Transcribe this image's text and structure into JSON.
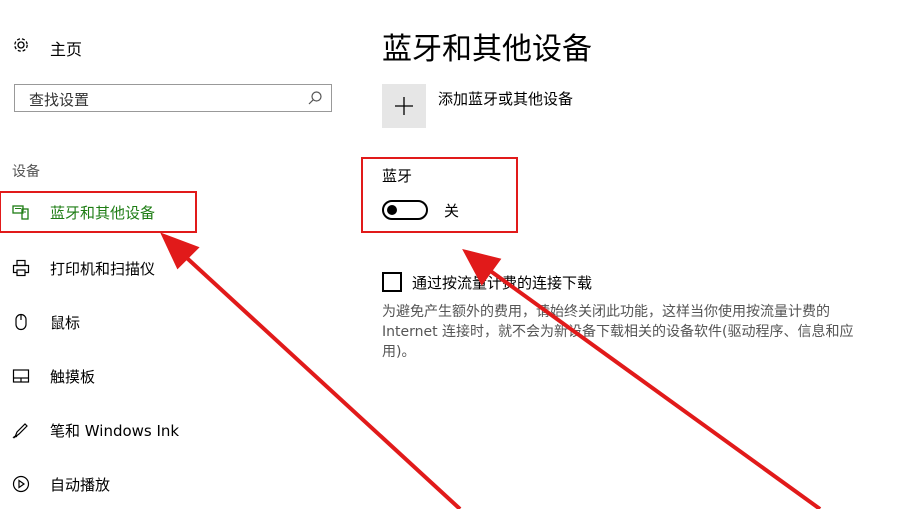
{
  "sidebar": {
    "home_label": "主页",
    "search_placeholder": "查找设置",
    "section_label": "设备",
    "items": [
      {
        "label": "蓝牙和其他设备",
        "icon": "bluetooth-devices-icon",
        "active": true
      },
      {
        "label": "打印机和扫描仪",
        "icon": "printer-icon",
        "active": false
      },
      {
        "label": "鼠标",
        "icon": "mouse-icon",
        "active": false
      },
      {
        "label": "触摸板",
        "icon": "touchpad-icon",
        "active": false
      },
      {
        "label": "笔和 Windows Ink",
        "icon": "pen-icon",
        "active": false
      },
      {
        "label": "自动播放",
        "icon": "autoplay-icon",
        "active": false
      }
    ]
  },
  "main": {
    "title": "蓝牙和其他设备",
    "add_device_label": "添加蓝牙或其他设备",
    "bluetooth_label": "蓝牙",
    "bluetooth_state": "关",
    "bluetooth_on": false,
    "metered_label": "通过按流量计费的连接下载",
    "metered_checked": false,
    "metered_desc": "为避免产生额外的费用，请始终关闭此功能，这样当你使用按流量计费的 Internet 连接时，就不会为新设备下载相关的设备软件(驱动程序、信息和应用)。"
  },
  "colors": {
    "accent_active": "#1e7d14",
    "highlight_red": "#e11a1a"
  }
}
